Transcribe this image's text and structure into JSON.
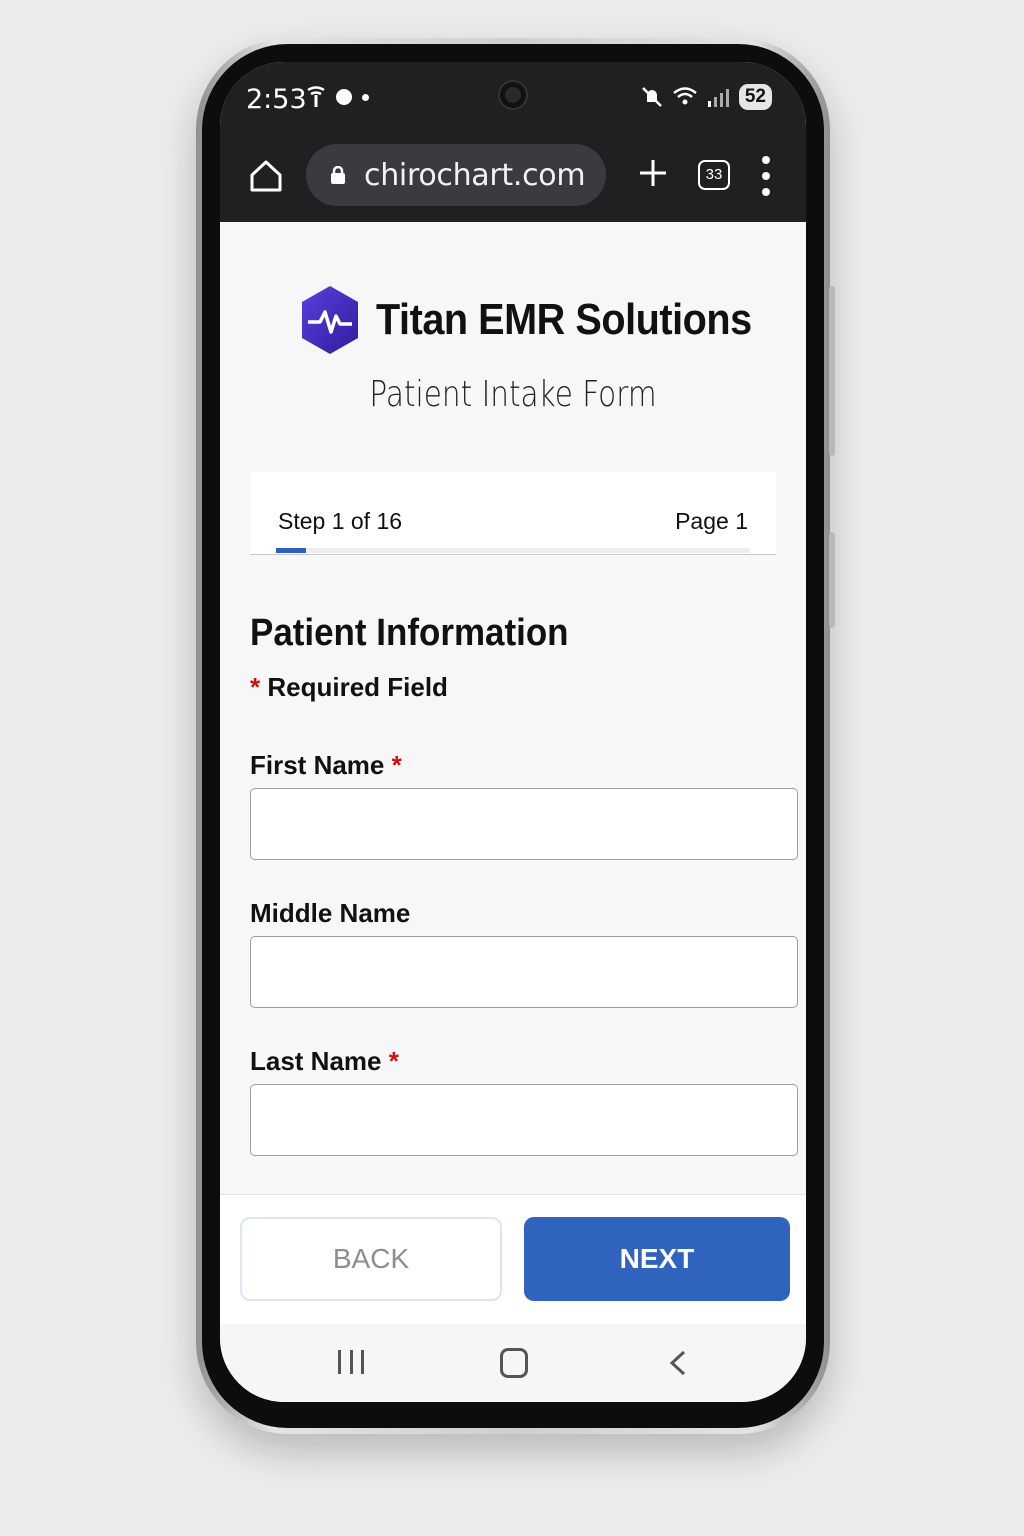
{
  "status_bar": {
    "time": "2:53",
    "battery": "52",
    "icons_left": [
      "antenna-icon",
      "dot-icon",
      "small-dot-icon"
    ],
    "icons_right": [
      "mute-icon",
      "wifi-icon",
      "signal-icon"
    ]
  },
  "browser": {
    "url": "chirochart.com",
    "tab_count": "33",
    "icons": [
      "home-icon",
      "lock-icon",
      "plus-icon",
      "tabs-icon",
      "more-icon"
    ]
  },
  "brand": {
    "name": "Titan EMR Solutions",
    "logo_color": "#3f2bbd"
  },
  "form": {
    "subtitle": "Patient Intake Form",
    "step_label": "Step 1 of 16",
    "page_label": "Page 1",
    "progress_fraction": 0.0625,
    "section_title": "Patient Information",
    "required_star": "*",
    "required_note": "Required Field",
    "fields": [
      {
        "label": "First Name",
        "required": "*",
        "value": ""
      },
      {
        "label": "Middle Name",
        "required": "",
        "value": ""
      },
      {
        "label": "Last Name",
        "required": "*",
        "value": ""
      }
    ]
  },
  "buttons": {
    "back": "BACK",
    "next": "NEXT"
  },
  "colors": {
    "accent": "#2f63bd",
    "required": "#cc1010"
  }
}
